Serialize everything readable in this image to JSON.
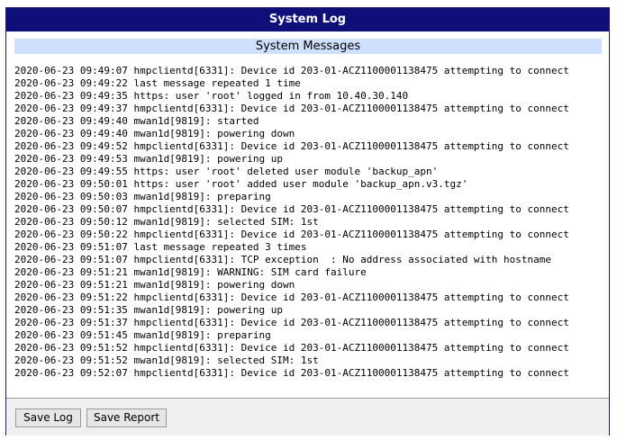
{
  "window": {
    "title": "System Log"
  },
  "section": {
    "title": "System Messages"
  },
  "log": {
    "lines": [
      "2020-06-23 09:49:07 hmpclientd[6331]: Device id 203-01-ACZ1100001138475 attempting to connect",
      "2020-06-23 09:49:22 last message repeated 1 time",
      "2020-06-23 09:49:35 https: user 'root' logged in from 10.40.30.140",
      "2020-06-23 09:49:37 hmpclientd[6331]: Device id 203-01-ACZ1100001138475 attempting to connect",
      "2020-06-23 09:49:40 mwan1d[9819]: started",
      "2020-06-23 09:49:40 mwan1d[9819]: powering down",
      "2020-06-23 09:49:52 hmpclientd[6331]: Device id 203-01-ACZ1100001138475 attempting to connect",
      "2020-06-23 09:49:53 mwan1d[9819]: powering up",
      "2020-06-23 09:49:55 https: user 'root' deleted user module 'backup_apn'",
      "2020-06-23 09:50:01 https: user 'root' added user module 'backup_apn.v3.tgz'",
      "2020-06-23 09:50:03 mwan1d[9819]: preparing",
      "2020-06-23 09:50:07 hmpclientd[6331]: Device id 203-01-ACZ1100001138475 attempting to connect",
      "2020-06-23 09:50:12 mwan1d[9819]: selected SIM: 1st",
      "2020-06-23 09:50:22 hmpclientd[6331]: Device id 203-01-ACZ1100001138475 attempting to connect",
      "2020-06-23 09:51:07 last message repeated 3 times",
      "2020-06-23 09:51:07 hmpclientd[6331]: TCP exception  : No address associated with hostname",
      "2020-06-23 09:51:21 mwan1d[9819]: WARNING: SIM card failure",
      "2020-06-23 09:51:21 mwan1d[9819]: powering down",
      "2020-06-23 09:51:22 hmpclientd[6331]: Device id 203-01-ACZ1100001138475 attempting to connect",
      "2020-06-23 09:51:35 mwan1d[9819]: powering up",
      "2020-06-23 09:51:37 hmpclientd[6331]: Device id 203-01-ACZ1100001138475 attempting to connect",
      "2020-06-23 09:51:45 mwan1d[9819]: preparing",
      "2020-06-23 09:51:52 hmpclientd[6331]: Device id 203-01-ACZ1100001138475 attempting to connect",
      "2020-06-23 09:51:52 mwan1d[9819]: selected SIM: 1st",
      "2020-06-23 09:52:07 hmpclientd[6331]: Device id 203-01-ACZ1100001138475 attempting to connect"
    ]
  },
  "buttons": {
    "save_log": "Save Log",
    "save_report": "Save Report"
  },
  "colors": {
    "titlebar": "#0f0f7a",
    "section_header": "#cfe0ff",
    "footer": "#f0f0f0"
  }
}
